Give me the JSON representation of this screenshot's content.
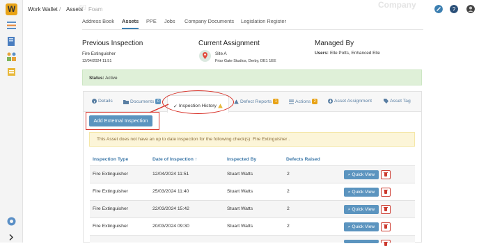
{
  "app": {
    "logo_text": "W"
  },
  "breadcrumb": {
    "home": "Work Wallet",
    "sep1": "/",
    "assets": "Assets",
    "sep2": "/",
    "current": "Foam",
    "faint_title": "ng ...",
    "faint_company": "Company"
  },
  "asset_tabs": [
    {
      "label": "Address Book"
    },
    {
      "label": "Assets"
    },
    {
      "label": "PPE"
    },
    {
      "label": "Jobs"
    },
    {
      "label": "Company Documents"
    },
    {
      "label": "Legislation Register"
    }
  ],
  "previous_inspection": {
    "heading": "Previous Inspection",
    "type": "Fire Extinguisher",
    "date": "12/04/2024 11:51"
  },
  "current_assignment": {
    "heading": "Current Assignment",
    "site": "Site A",
    "address": "Friar Gate Studios, Derby, DE1 1EE"
  },
  "managed_by": {
    "heading": "Managed By",
    "label": "Users:",
    "users": "Elle Potts, Enhanced Elle"
  },
  "status": {
    "label": "Status:",
    "value": "Active"
  },
  "detail_tabs": [
    {
      "label": "Details"
    },
    {
      "label": "Documents",
      "badge": "0"
    },
    {
      "label": "Inspection History",
      "icon": "warning-icon"
    },
    {
      "label": "Defect Reports",
      "badge": "1"
    },
    {
      "label": "Actions",
      "badge": "2"
    },
    {
      "label": "Asset Assignment"
    },
    {
      "label": "Asset Tag"
    }
  ],
  "add_button": "Add External Inspection",
  "warning": "This Asset does not have an up to date inspection for the following check(s): Fire Extinguisher .",
  "table": {
    "headers": [
      "Inspection Type",
      "Date of Inspection",
      "Inspected By",
      "Defects Raised"
    ],
    "sort_arrow": "↑",
    "rows": [
      {
        "type": "Fire Extinguisher",
        "date": "12/04/2024 11:51",
        "by": "Stuart Watts",
        "defects": "2"
      },
      {
        "type": "Fire Extinguisher",
        "date": "25/03/2024 11:40",
        "by": "Stuart Watts",
        "defects": "2"
      },
      {
        "type": "Fire Extinguisher",
        "date": "22/03/2024 15:42",
        "by": "Stuart Watts",
        "defects": "2"
      },
      {
        "type": "Fire Extinguisher",
        "date": "20/03/2024 09:30",
        "by": "Stuart Watts",
        "defects": "2"
      }
    ],
    "quick_view_label": "Quick View"
  },
  "colors": {
    "accent": "#5b94bf",
    "annotation": "#d8332a",
    "success_bg": "#dff0d8",
    "warning_bg": "#fcf5d8"
  }
}
